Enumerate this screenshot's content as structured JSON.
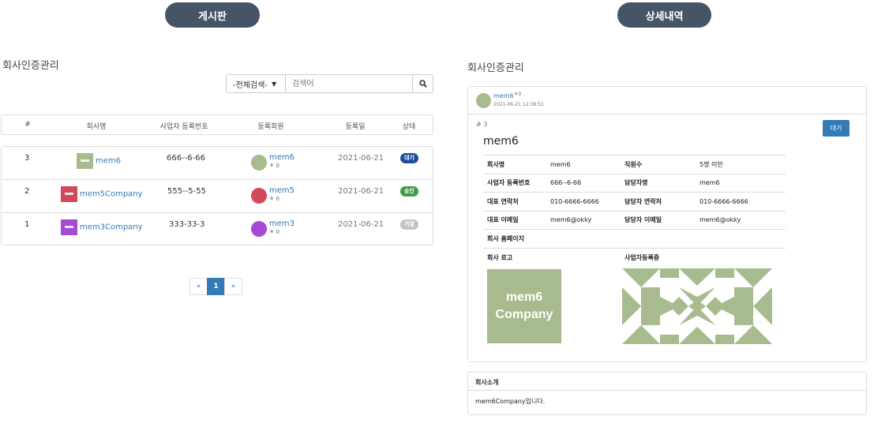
{
  "left": {
    "nav_label": "게시판",
    "title": "회사인증관리",
    "search": {
      "select_value": "-전체검색-",
      "placeholder": "검색어"
    },
    "columns": [
      "#",
      "회사명",
      "사업자 등록번호",
      "등록회원",
      "등록일",
      "상태"
    ],
    "rows": [
      {
        "no": "3",
        "company": "mem6",
        "reg_no": "666--6-66",
        "member": "mem6",
        "points": "0",
        "date": "2021-06-21",
        "status": "대기",
        "status_color": "#1d4e9e",
        "logo_color": "#a8bb8e",
        "avatar_color": "#a8bb8e"
      },
      {
        "no": "2",
        "company": "mem5Company",
        "reg_no": "555--5-55",
        "member": "mem5",
        "points": "0",
        "date": "2021-06-21",
        "status": "승인",
        "status_color": "#3e9a45",
        "logo_color": "#d2495a",
        "avatar_color": "#d2495a"
      },
      {
        "no": "1",
        "company": "mem3Company",
        "reg_no": "333-33-3",
        "member": "mem3",
        "points": "0",
        "date": "2021-06-21",
        "status": "거절",
        "status_color": "#c4c4c4",
        "logo_color": "#a54ad4",
        "avatar_color": "#a54ad4"
      }
    ],
    "pagination": [
      "«",
      "1",
      "»"
    ]
  },
  "right": {
    "nav_label": "상세내역",
    "title": "회사인증관리",
    "author": {
      "name": "mem6",
      "points": "0",
      "datetime": "2021-06-21 12:38:51"
    },
    "number": "# 3",
    "status_button": "대기",
    "company_title": "mem6",
    "info": [
      [
        "회사명",
        "mem6",
        "직원수",
        "5명 미만"
      ],
      [
        "사업자 등록번호",
        "666--6-66",
        "담당자명",
        "mem6"
      ],
      [
        "대표 연락처",
        "010-6666-6666",
        "담당자 연락처",
        "010-6666-6666"
      ],
      [
        "대표 이메일",
        "mem6@okky",
        "담당자 이메일",
        "mem6@okky"
      ],
      [
        "회사 홈페이지",
        "",
        "",
        ""
      ],
      [
        "회사 로고",
        "",
        "사업자등록증",
        ""
      ]
    ],
    "logo_text_1": "mem6",
    "logo_text_2": "Company",
    "intro_header": "회사소개",
    "intro_body": "mem6Company입니다."
  },
  "colors": {
    "nav_pill": "#465566",
    "link": "#337ab7",
    "logo_green": "#a8bb8e"
  }
}
